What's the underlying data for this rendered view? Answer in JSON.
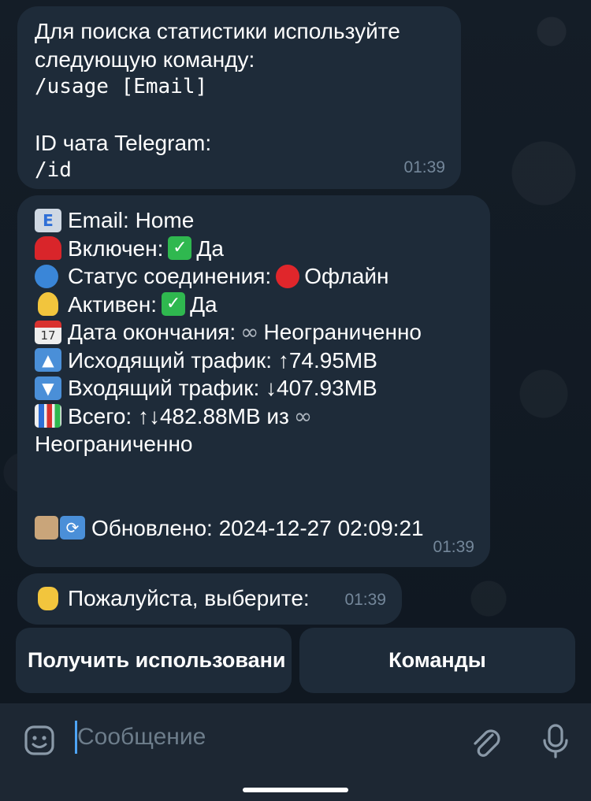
{
  "messages": {
    "m1": {
      "line1": "Для поиска статистики используйте",
      "line2": "следующую команду:",
      "cmd1": "/usage [Email]",
      "line3": "ID чата Telegram:",
      "cmd2": "/id",
      "time": "01:39"
    },
    "m2": {
      "email": "Email: Home",
      "enabled_label": "Включен:",
      "enabled_value": "Да",
      "conn_label": "Статус соединения:",
      "conn_value": "Офлайн",
      "active_label": "Активен:",
      "active_value": "Да",
      "end_label": "Дата окончания:",
      "end_value": "Неограниченно",
      "out_label": "Исходящий трафик: ↑74.95MB",
      "in_label": "Входящий трафик: ↓407.93MB",
      "total_label": "Всего: ↑↓482.88MB из",
      "total_value": "Неограниченно",
      "updated": "Обновлено: 2024-12-27 02:09:21",
      "time": "01:39"
    },
    "m3": {
      "text": "Пожалуйста, выберите:",
      "time": "01:39"
    }
  },
  "keyboard": {
    "button1": "Получить использовани",
    "button2": "Команды"
  },
  "composer": {
    "placeholder": "Сообщение"
  },
  "icons": {
    "infinity": "∞",
    "check": "✓"
  },
  "colors": {
    "background": "#0e1621",
    "bubble": "#1e2b39",
    "time": "#74879a",
    "accent": "#4ea4f5"
  }
}
